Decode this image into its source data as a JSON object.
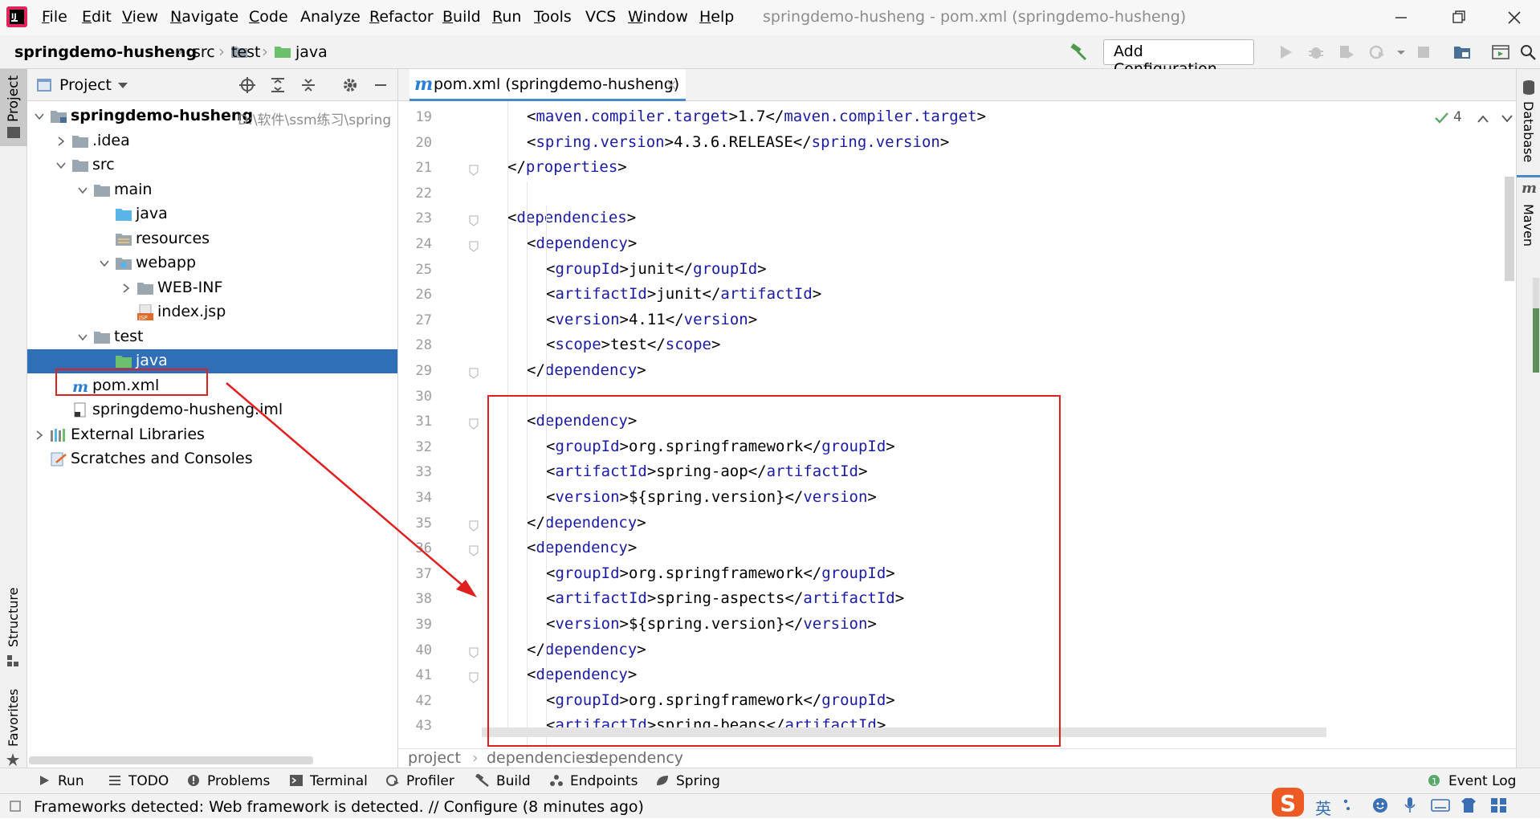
{
  "window": {
    "title": "springdemo-husheng - pom.xml (springdemo-husheng)"
  },
  "menu": [
    {
      "label": "File",
      "u": "F",
      "rest": "ile"
    },
    {
      "label": "Edit",
      "u": "E",
      "rest": "dit"
    },
    {
      "label": "View",
      "u": "V",
      "rest": "iew"
    },
    {
      "label": "Navigate",
      "u": "N",
      "rest": "avigate"
    },
    {
      "label": "Code",
      "u": "C",
      "rest": "ode"
    },
    {
      "label": "Analyze",
      "u": "",
      "rest": "Analyze"
    },
    {
      "label": "Refactor",
      "u": "R",
      "rest": "efactor"
    },
    {
      "label": "Build",
      "u": "B",
      "rest": "uild"
    },
    {
      "label": "Run",
      "u": "R",
      "rest": "un"
    },
    {
      "label": "Tools",
      "u": "T",
      "rest": "ools"
    },
    {
      "label": "VCS",
      "u": "",
      "rest": "VCS"
    },
    {
      "label": "Window",
      "u": "W",
      "rest": "indow"
    },
    {
      "label": "Help",
      "u": "H",
      "rest": "elp"
    }
  ],
  "breadcrumbs": [
    "springdemo-husheng",
    "src",
    "test",
    "java"
  ],
  "toolbar": {
    "add_configuration": "Add Configuration..."
  },
  "left_tabs": {
    "project": "Project",
    "structure": "Structure",
    "favorites": "Favorites"
  },
  "right_tabs": {
    "database": "Database",
    "maven": "Maven"
  },
  "project_panel": {
    "title": "Project",
    "tree": [
      {
        "label": "springdemo-husheng",
        "path": "D:\\软件\\ssm练习\\spring",
        "bold": true,
        "depth": 0,
        "arrow": "down",
        "icon": "module-folder-icon"
      },
      {
        "label": ".idea",
        "depth": 1,
        "arrow": "right",
        "icon": "folder-icon"
      },
      {
        "label": "src",
        "depth": 1,
        "arrow": "down",
        "icon": "folder-icon"
      },
      {
        "label": "main",
        "depth": 2,
        "arrow": "down",
        "icon": "folder-icon"
      },
      {
        "label": "java",
        "depth": 3,
        "arrow": "",
        "icon": "source-folder-icon"
      },
      {
        "label": "resources",
        "depth": 3,
        "arrow": "",
        "icon": "resources-folder-icon"
      },
      {
        "label": "webapp",
        "depth": 3,
        "arrow": "down",
        "icon": "web-folder-icon"
      },
      {
        "label": "WEB-INF",
        "depth": 4,
        "arrow": "right",
        "icon": "folder-icon"
      },
      {
        "label": "index.jsp",
        "depth": 4,
        "arrow": "",
        "icon": "jsp-file-icon"
      },
      {
        "label": "test",
        "depth": 2,
        "arrow": "down",
        "icon": "folder-icon"
      },
      {
        "label": "java",
        "depth": 3,
        "arrow": "",
        "icon": "test-source-folder-icon",
        "selected": true
      },
      {
        "label": "pom.xml",
        "depth": 1,
        "arrow": "",
        "icon": "maven-file-icon"
      },
      {
        "label": "springdemo-husheng.iml",
        "depth": 1,
        "arrow": "",
        "icon": "iml-file-icon"
      },
      {
        "label": "External Libraries",
        "depth": 0,
        "arrow": "right",
        "icon": "libraries-icon"
      },
      {
        "label": "Scratches and Consoles",
        "depth": 0,
        "arrow": "",
        "icon": "scratches-icon"
      }
    ]
  },
  "editor": {
    "tab_label": "pom.xml (springdemo-husheng)",
    "inspection_count": "4",
    "lines": [
      {
        "n": "19",
        "indent": 2,
        "parts": [
          [
            "br",
            "<"
          ],
          [
            "tag",
            "maven.compiler.target"
          ],
          [
            "br",
            ">"
          ],
          [
            "txt",
            "1.7"
          ],
          [
            "br",
            "</"
          ],
          [
            "tag",
            "maven.compiler.target"
          ],
          [
            "br",
            ">"
          ]
        ]
      },
      {
        "n": "20",
        "indent": 2,
        "parts": [
          [
            "br",
            "<"
          ],
          [
            "tag",
            "spring.version"
          ],
          [
            "br",
            ">"
          ],
          [
            "txt",
            "4.3.6.RELEASE"
          ],
          [
            "br",
            "</"
          ],
          [
            "tag",
            "spring.version"
          ],
          [
            "br",
            ">"
          ]
        ]
      },
      {
        "n": "21",
        "indent": 1,
        "fold": true,
        "parts": [
          [
            "br",
            "</"
          ],
          [
            "tag",
            "properties"
          ],
          [
            "br",
            ">"
          ]
        ]
      },
      {
        "n": "22",
        "indent": 0,
        "parts": []
      },
      {
        "n": "23",
        "indent": 1,
        "fold": true,
        "parts": [
          [
            "br",
            "<"
          ],
          [
            "tag",
            "dependencies"
          ],
          [
            "br",
            ">"
          ]
        ]
      },
      {
        "n": "24",
        "indent": 2,
        "fold": true,
        "parts": [
          [
            "br",
            "<"
          ],
          [
            "tag",
            "dependency"
          ],
          [
            "br",
            ">"
          ]
        ]
      },
      {
        "n": "25",
        "indent": 3,
        "parts": [
          [
            "br",
            "<"
          ],
          [
            "tag",
            "groupId"
          ],
          [
            "br",
            ">"
          ],
          [
            "txt",
            "junit"
          ],
          [
            "br",
            "</"
          ],
          [
            "tag",
            "groupId"
          ],
          [
            "br",
            ">"
          ]
        ]
      },
      {
        "n": "26",
        "indent": 3,
        "parts": [
          [
            "br",
            "<"
          ],
          [
            "tag",
            "artifactId"
          ],
          [
            "br",
            ">"
          ],
          [
            "txt",
            "junit"
          ],
          [
            "br",
            "</"
          ],
          [
            "tag",
            "artifactId"
          ],
          [
            "br",
            ">"
          ]
        ]
      },
      {
        "n": "27",
        "indent": 3,
        "parts": [
          [
            "br",
            "<"
          ],
          [
            "tag",
            "version"
          ],
          [
            "br",
            ">"
          ],
          [
            "txt",
            "4.11"
          ],
          [
            "br",
            "</"
          ],
          [
            "tag",
            "version"
          ],
          [
            "br",
            ">"
          ]
        ]
      },
      {
        "n": "28",
        "indent": 3,
        "parts": [
          [
            "br",
            "<"
          ],
          [
            "tag",
            "scope"
          ],
          [
            "br",
            ">"
          ],
          [
            "txt",
            "test"
          ],
          [
            "br",
            "</"
          ],
          [
            "tag",
            "scope"
          ],
          [
            "br",
            ">"
          ]
        ]
      },
      {
        "n": "29",
        "indent": 2,
        "fold": true,
        "parts": [
          [
            "br",
            "</"
          ],
          [
            "tag",
            "dependency"
          ],
          [
            "br",
            ">"
          ]
        ]
      },
      {
        "n": "30",
        "indent": 0,
        "parts": []
      },
      {
        "n": "31",
        "indent": 2,
        "fold": true,
        "parts": [
          [
            "br",
            "<"
          ],
          [
            "tag",
            "dependency"
          ],
          [
            "br",
            ">"
          ]
        ]
      },
      {
        "n": "32",
        "indent": 3,
        "parts": [
          [
            "br",
            "<"
          ],
          [
            "tag",
            "groupId"
          ],
          [
            "br",
            ">"
          ],
          [
            "txt",
            "org.springframework"
          ],
          [
            "br",
            "</"
          ],
          [
            "tag",
            "groupId"
          ],
          [
            "br",
            ">"
          ]
        ]
      },
      {
        "n": "33",
        "indent": 3,
        "parts": [
          [
            "br",
            "<"
          ],
          [
            "tag",
            "artifactId"
          ],
          [
            "br",
            ">"
          ],
          [
            "txt",
            "spring-aop"
          ],
          [
            "br",
            "</"
          ],
          [
            "tag",
            "artifactId"
          ],
          [
            "br",
            ">"
          ]
        ]
      },
      {
        "n": "34",
        "indent": 3,
        "parts": [
          [
            "br",
            "<"
          ],
          [
            "tag",
            "version"
          ],
          [
            "br",
            ">"
          ],
          [
            "txt",
            "${spring.version}"
          ],
          [
            "br",
            "</"
          ],
          [
            "tag",
            "version"
          ],
          [
            "br",
            ">"
          ]
        ]
      },
      {
        "n": "35",
        "indent": 2,
        "fold": true,
        "parts": [
          [
            "br",
            "</"
          ],
          [
            "tag",
            "dependency"
          ],
          [
            "br",
            ">"
          ]
        ]
      },
      {
        "n": "36",
        "indent": 2,
        "fold": true,
        "parts": [
          [
            "br",
            "<"
          ],
          [
            "tag",
            "dependency"
          ],
          [
            "br",
            ">"
          ]
        ]
      },
      {
        "n": "37",
        "indent": 3,
        "parts": [
          [
            "br",
            "<"
          ],
          [
            "tag",
            "groupId"
          ],
          [
            "br",
            ">"
          ],
          [
            "txt",
            "org.springframework"
          ],
          [
            "br",
            "</"
          ],
          [
            "tag",
            "groupId"
          ],
          [
            "br",
            ">"
          ]
        ]
      },
      {
        "n": "38",
        "indent": 3,
        "parts": [
          [
            "br",
            "<"
          ],
          [
            "tag",
            "artifactId"
          ],
          [
            "br",
            ">"
          ],
          [
            "txt",
            "spring-aspects"
          ],
          [
            "br",
            "</"
          ],
          [
            "tag",
            "artifactId"
          ],
          [
            "br",
            ">"
          ]
        ]
      },
      {
        "n": "39",
        "indent": 3,
        "parts": [
          [
            "br",
            "<"
          ],
          [
            "tag",
            "version"
          ],
          [
            "br",
            ">"
          ],
          [
            "txt",
            "${spring.version}"
          ],
          [
            "br",
            "</"
          ],
          [
            "tag",
            "version"
          ],
          [
            "br",
            ">"
          ]
        ]
      },
      {
        "n": "40",
        "indent": 2,
        "fold": true,
        "parts": [
          [
            "br",
            "</"
          ],
          [
            "tag",
            "dependency"
          ],
          [
            "br",
            ">"
          ]
        ]
      },
      {
        "n": "41",
        "indent": 2,
        "fold": true,
        "parts": [
          [
            "br",
            "<"
          ],
          [
            "tag",
            "dependency"
          ],
          [
            "br",
            ">"
          ]
        ]
      },
      {
        "n": "42",
        "indent": 3,
        "parts": [
          [
            "br",
            "<"
          ],
          [
            "tag",
            "groupId"
          ],
          [
            "br",
            ">"
          ],
          [
            "txt",
            "org.springframework"
          ],
          [
            "br",
            "</"
          ],
          [
            "tag",
            "groupId"
          ],
          [
            "br",
            ">"
          ]
        ]
      },
      {
        "n": "43",
        "indent": 3,
        "parts": [
          [
            "br",
            "<"
          ],
          [
            "tag",
            "artifactId"
          ],
          [
            "br",
            ">"
          ],
          [
            "txt",
            "spring-beans"
          ],
          [
            "br",
            "</"
          ],
          [
            "tag",
            "artifactId"
          ],
          [
            "br",
            ">"
          ]
        ]
      }
    ],
    "breadcrumb": [
      "project",
      "dependencies",
      "dependency"
    ]
  },
  "tool_windows": [
    {
      "label": "Run",
      "icon": "run-icon"
    },
    {
      "label": "TODO",
      "icon": "todo-icon"
    },
    {
      "label": "Problems",
      "icon": "problems-icon"
    },
    {
      "label": "Terminal",
      "icon": "terminal-icon"
    },
    {
      "label": "Profiler",
      "icon": "profiler-icon"
    },
    {
      "label": "Build",
      "icon": "build-icon"
    },
    {
      "label": "Endpoints",
      "icon": "endpoints-icon"
    },
    {
      "label": "Spring",
      "icon": "spring-icon"
    }
  ],
  "event_log": "Event Log",
  "status": {
    "message": "Frameworks detected: Web framework is detected. // Configure (8 minutes ago)"
  },
  "ime": {
    "lang": "英"
  },
  "colors": {
    "selection": "#2f6fb8",
    "tag": "#1a1aa6",
    "annotation": "#e02020",
    "maven": "#2a7fd4",
    "folder": "#9aa7b0",
    "source_folder": "#5ab4e8"
  }
}
